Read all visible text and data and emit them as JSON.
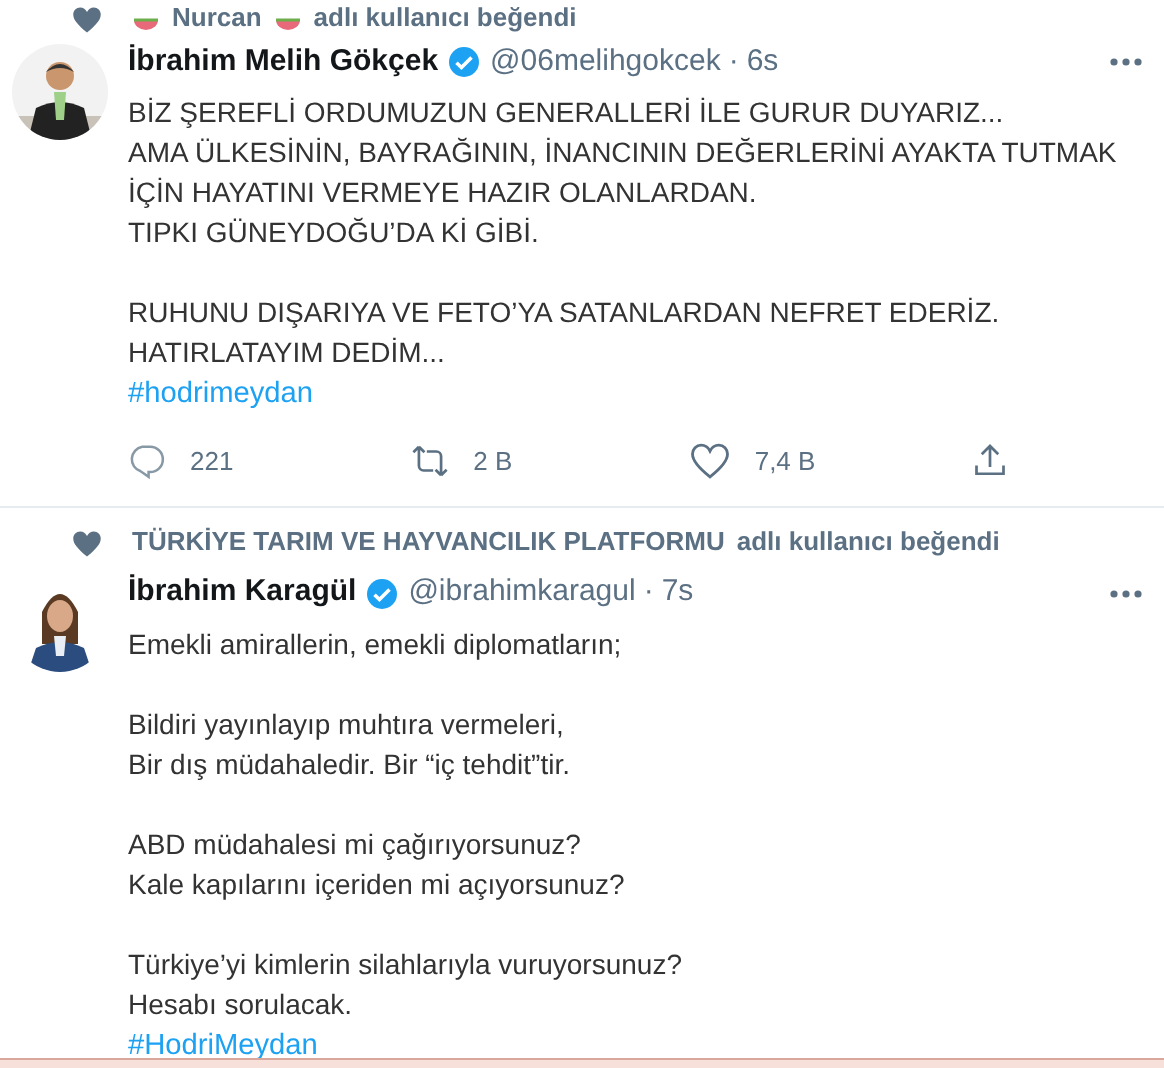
{
  "tweets": [
    {
      "liked_by": {
        "name": "Nurcan",
        "suffix": "adlı kullanıcı beğendi",
        "name_emoji": true
      },
      "author": {
        "name": "İbrahim Melih Gökçek",
        "verified": true,
        "handle": "@06melihgokcek",
        "separator": "·",
        "time": "6s"
      },
      "paragraphs": [
        "BİZ ŞEREFLİ ORDUMUZUN GENERALLERİ İLE GURUR DUYARIZ...\nAMA ÜLKESİNİN, BAYRAĞININ, İNANCININ DEĞERLERİNİ AYAKTA TUTMAK İÇİN HAYATINI VERMEYE HAZIR OLANLARDAN.\nTIPKI GÜNEYDOĞU’DA Kİ GİBİ.",
        "RUHUNU DIŞARIYA VE FETO’YA SATANLARDAN NEFRET EDERİZ.\nHATIRLATAYIM DEDİM..."
      ],
      "hashtag": "#hodrimeydan",
      "replies": "221",
      "retweets": "2 B",
      "likes": "7,4 B"
    },
    {
      "liked_by": {
        "name": "TÜRKİYE TARIM VE HAYVANCILIK PLATFORMU",
        "suffix": "adlı kullanıcı beğendi",
        "name_emoji": false
      },
      "author": {
        "name": "İbrahim Karagül",
        "verified": true,
        "handle": "@ibrahimkaragul",
        "separator": "·",
        "time": "7s"
      },
      "paragraphs": [
        "Emekli amirallerin, emekli diplomatların;",
        "Bildiri yayınlayıp muhtıra vermeleri,\nBir dış müdahaledir. Bir “iç tehdit”tir.",
        "ABD müdahalesi mi çağırıyorsunuz?\nKale kapılarını içeriden mi açıyorsunuz?",
        "Türkiye’yi kimlerin silahlarıyla vuruyorsunuz?\nHesabı sorulacak."
      ],
      "hashtag": "#HodriMeydan"
    }
  ]
}
